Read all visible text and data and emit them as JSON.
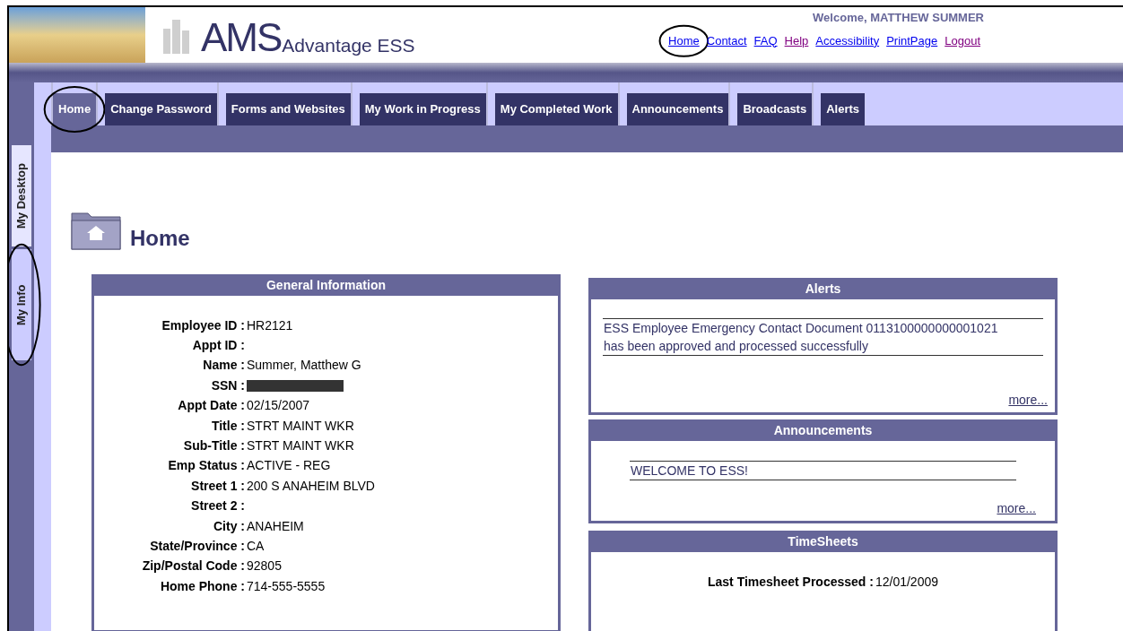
{
  "header": {
    "logo_main": "AMS",
    "logo_sub": "Advantage ESS",
    "welcome": "Welcome, MATTHEW SUMMER",
    "links": [
      {
        "label": "Home",
        "visited": false,
        "circled": true
      },
      {
        "label": "Contact",
        "visited": false,
        "circled": false
      },
      {
        "label": "FAQ",
        "visited": false,
        "circled": false
      },
      {
        "label": "Help",
        "visited": true,
        "circled": false
      },
      {
        "label": "Accessibility",
        "visited": false,
        "circled": false
      },
      {
        "label": "PrintPage",
        "visited": false,
        "circled": false
      },
      {
        "label": "Logout",
        "visited": true,
        "circled": false
      }
    ]
  },
  "tabs": [
    {
      "label": "Home",
      "selected": true,
      "circled": true
    },
    {
      "label": "Change Password",
      "selected": false,
      "circled": false
    },
    {
      "label": "Forms and Websites",
      "selected": false,
      "circled": false
    },
    {
      "label": "My Work in Progress",
      "selected": false,
      "circled": false
    },
    {
      "label": "My Completed Work",
      "selected": false,
      "circled": false
    },
    {
      "label": "Announcements",
      "selected": false,
      "circled": false
    },
    {
      "label": "Broadcasts",
      "selected": false,
      "circled": false
    },
    {
      "label": "Alerts",
      "selected": false,
      "circled": false
    }
  ],
  "side_tabs": [
    {
      "label": "My Desktop",
      "selected": true,
      "circled": false
    },
    {
      "label": "My Info",
      "selected": false,
      "circled": true
    }
  ],
  "page_title": "Home",
  "general_information": {
    "title": "General Information",
    "fields": [
      {
        "label": "Employee ID :",
        "value": "HR2121"
      },
      {
        "label": "Appt ID :"
      },
      {
        "label": "Name :",
        "value": "Summer, Matthew G"
      },
      {
        "label": "SSN :",
        "redacted": true
      },
      {
        "label": "Appt Date :",
        "value": "02/15/2007"
      },
      {
        "label": "Title :",
        "value": "STRT MAINT WKR"
      },
      {
        "label": "Sub-Title :",
        "value": "STRT MAINT WKR"
      },
      {
        "label": "Emp Status :",
        "value": "ACTIVE - REG"
      },
      {
        "label": "Street 1 :",
        "value": "200 S ANAHEIM BLVD"
      },
      {
        "label": "Street 2 :"
      },
      {
        "label": "City :",
        "value": "ANAHEIM"
      },
      {
        "label": "State/Province :",
        "value": "CA"
      },
      {
        "label": "Zip/Postal Code :",
        "value": "92805"
      },
      {
        "label": "Home Phone :",
        "value": "714-555-5555"
      }
    ]
  },
  "alerts": {
    "title": "Alerts",
    "items": [
      "ESS Employee Emergency Contact Document 0113100000000001021 has been approved and processed successfully"
    ],
    "more": "more..."
  },
  "announcements": {
    "title": "Announcements",
    "items": [
      "WELCOME TO ESS!"
    ],
    "more": "more..."
  },
  "timesheets": {
    "title": "TimeSheets",
    "label": "Last Timesheet Processed :",
    "value": "12/01/2009"
  }
}
